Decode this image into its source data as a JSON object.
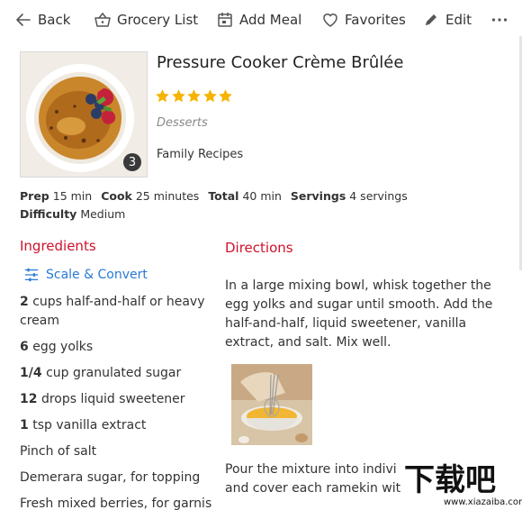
{
  "toolbar": {
    "back_label": "Back",
    "grocery_label": "Grocery List",
    "add_meal_label": "Add Meal",
    "favorites_label": "Favorites",
    "edit_label": "Edit"
  },
  "recipe": {
    "title": "Pressure Cooker Crème Brûlée",
    "rating": 5,
    "category": "Desserts",
    "collection": "Family Recipes",
    "photo_count": "3"
  },
  "meta": {
    "prep_label": "Prep",
    "prep_value": "15 min",
    "cook_label": "Cook",
    "cook_value": "25 minutes",
    "total_label": "Total",
    "total_value": "40 min",
    "servings_label": "Servings",
    "servings_value": "4 servings",
    "difficulty_label": "Difficulty",
    "difficulty_value": "Medium"
  },
  "ingredients": {
    "heading": "Ingredients",
    "scale_label": "Scale & Convert",
    "items": [
      {
        "qty": "2",
        "text": "cups half-and-half or heavy cream"
      },
      {
        "qty": "6",
        "text": "egg yolks"
      },
      {
        "qty": "1/4",
        "text": "cup granulated sugar"
      },
      {
        "qty": "12",
        "text": "drops liquid sweetener"
      },
      {
        "qty": "1",
        "text": "tsp vanilla extract"
      },
      {
        "qty": "",
        "text": "Pinch of salt"
      },
      {
        "qty": "",
        "text": "Demerara sugar, for topping"
      },
      {
        "qty": "",
        "text": "Fresh mixed berries, for garnis"
      }
    ]
  },
  "directions": {
    "heading": "Directions",
    "step1": "In a large mixing bowl, whisk together the egg yolks and sugar until smooth. Add the half-and-half, liquid sweetener, vanilla extract, and salt. Mix well.",
    "step2": "Pour the mixture into indivi and cover each ramekin wit"
  },
  "watermark": {
    "text": "下载吧",
    "url": "www.xiazaiba.com"
  },
  "colors": {
    "accent_red": "#d0112b",
    "link_blue": "#2a7ad5",
    "star_gold": "#f5b400"
  }
}
